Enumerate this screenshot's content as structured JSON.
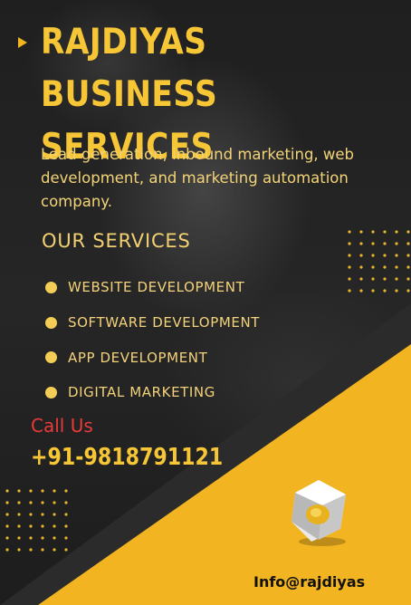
{
  "brand": {
    "title": "RAJDIYAS BUSINESS SERVICES",
    "tagline": "Lead generation, inbound marketing, web development, and marketing automation company."
  },
  "services": {
    "heading": "OUR SERVICES",
    "items": [
      {
        "label": "WEBSITE DEVELOPMENT"
      },
      {
        "label": "SOFTWARE DEVELOPMENT"
      },
      {
        "label": "APP DEVELOPMENT"
      },
      {
        "label": "DIGITAL MARKETING"
      }
    ]
  },
  "contact": {
    "call_label": "Call Us",
    "phone": "+91-9818791121",
    "email": "Info@rajdiyas"
  },
  "colors": {
    "accent_yellow": "#f2b51f",
    "text_yellow": "#f6c636",
    "call_red": "#e83a3a",
    "background": "#1f1f1f"
  },
  "icons": {
    "title_marker": "play-arrow-icon",
    "bullet": "filled-circle-icon",
    "logo": "cube-logo-icon"
  }
}
